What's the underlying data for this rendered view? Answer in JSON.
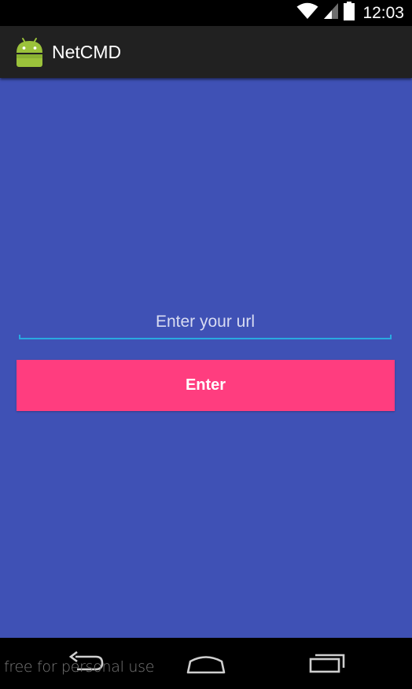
{
  "status_bar": {
    "time": "12:03",
    "icons": [
      "wifi-icon",
      "cellular-signal-icon",
      "battery-icon"
    ]
  },
  "action_bar": {
    "title": "NetCMD",
    "icon": "android-robot-icon"
  },
  "main": {
    "url_input": {
      "placeholder": "Enter your url",
      "value": ""
    },
    "enter_button_label": "Enter"
  },
  "nav_bar": {
    "icons": [
      "back-icon",
      "home-icon",
      "recent-apps-icon"
    ]
  },
  "watermark": "free for personal use",
  "colors": {
    "background": "#3f51b5",
    "action_bar": "#212121",
    "accent": "#ff3d7f",
    "input_underline": "#29a9e0",
    "android_green": "#9bc23b"
  }
}
